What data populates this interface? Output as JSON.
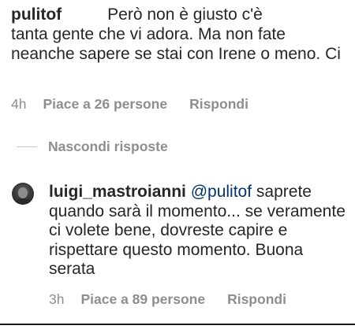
{
  "comment": {
    "username": "pulitof",
    "text_first": "Però non è giusto c'è",
    "text_rest": "tanta gente che vi adora. Ma non fate neanche sapere se stai con Irene o meno. Ci",
    "time": "4h",
    "likes": "Piace a 26 persone",
    "reply_label": "Rispondi"
  },
  "replies_toggle": {
    "label": "Nascondi risposte"
  },
  "reply": {
    "username": "luigi_mastroianni",
    "mention": "@pulitof",
    "text": "saprete quando sarà il momento... se veramente ci volete bene, dovreste capire e rispettare questo momento. Buona serata",
    "time": "3h",
    "likes": "Piace a 89 persone",
    "reply_label": "Rispondi"
  },
  "colors": {
    "text": "#262626",
    "meta": "#8e8e8e",
    "mention": "#00376b"
  }
}
